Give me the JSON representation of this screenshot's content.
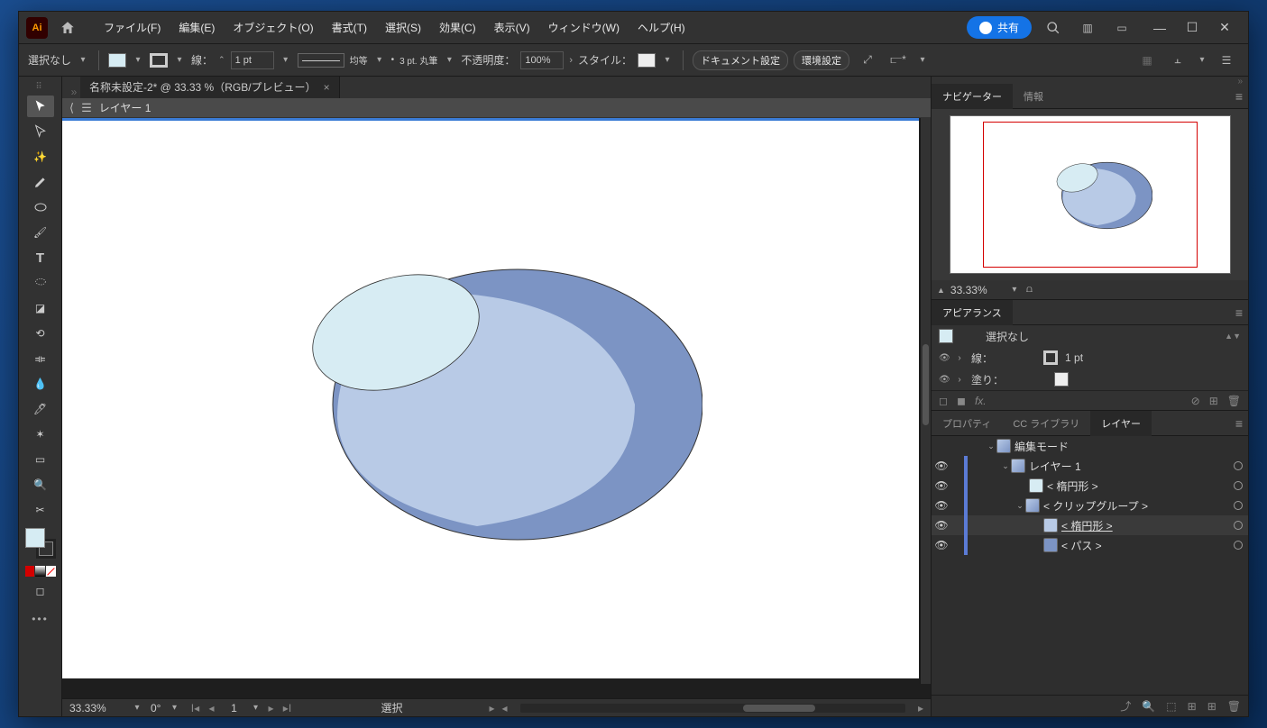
{
  "app": {
    "icon_text": "Ai"
  },
  "menu": {
    "file": "ファイル(F)",
    "edit": "編集(E)",
    "object": "オブジェクト(O)",
    "type": "書式(T)",
    "select": "選択(S)",
    "effect": "効果(C)",
    "view": "表示(V)",
    "window": "ウィンドウ(W)",
    "help": "ヘルプ(H)"
  },
  "titlebar": {
    "share": "共有"
  },
  "control": {
    "no_selection": "選択なし",
    "fill_color": "#d6ecf3",
    "stroke_label": "線：",
    "stroke_weight": "1 pt",
    "uniform_label": "均等",
    "brush_label": "3 pt. 丸筆",
    "opacity_label": "不透明度：",
    "opacity_value": "100%",
    "style_label": "スタイル：",
    "doc_setup": "ドキュメント設定",
    "env_setup": "環境設定"
  },
  "tab": {
    "title": "名称未設定-2* @ 33.33 %（RGB/プレビュー）"
  },
  "breadcrumb": {
    "layer": "レイヤー 1"
  },
  "status": {
    "zoom": "33.33%",
    "rotate": "0°",
    "page": "1",
    "mode": "選択"
  },
  "panels": {
    "navigator_tab": "ナビゲーター",
    "info_tab": "情報",
    "nav_zoom": "33.33%",
    "appearance_tab": "アピアランス",
    "appearance_no_sel": "選択なし",
    "appearance_stroke": "線：",
    "appearance_stroke_val": "1 pt",
    "appearance_fill": "塗り：",
    "properties_tab": "プロパティ",
    "cc_tab": "CC ライブラリ",
    "layers_tab": "レイヤー"
  },
  "layers": {
    "edit_mode": "編集モード",
    "layer1": "レイヤー 1",
    "ellipse": "< 楕円形 >",
    "clip_group": "< クリップグループ >",
    "ellipse2": "< 楕円形 >",
    "path": "< パス >"
  },
  "colors": {
    "accent": "#1473e6",
    "artboard_bg": "#ffffff",
    "shape_main": "#b8cae6",
    "shape_dark": "#7c94c4",
    "shape_light": "#d7ecf3",
    "shape_stroke": "#2a2a2a",
    "nav_box": "#d40000",
    "layer_strip": "#5b7bd5"
  }
}
